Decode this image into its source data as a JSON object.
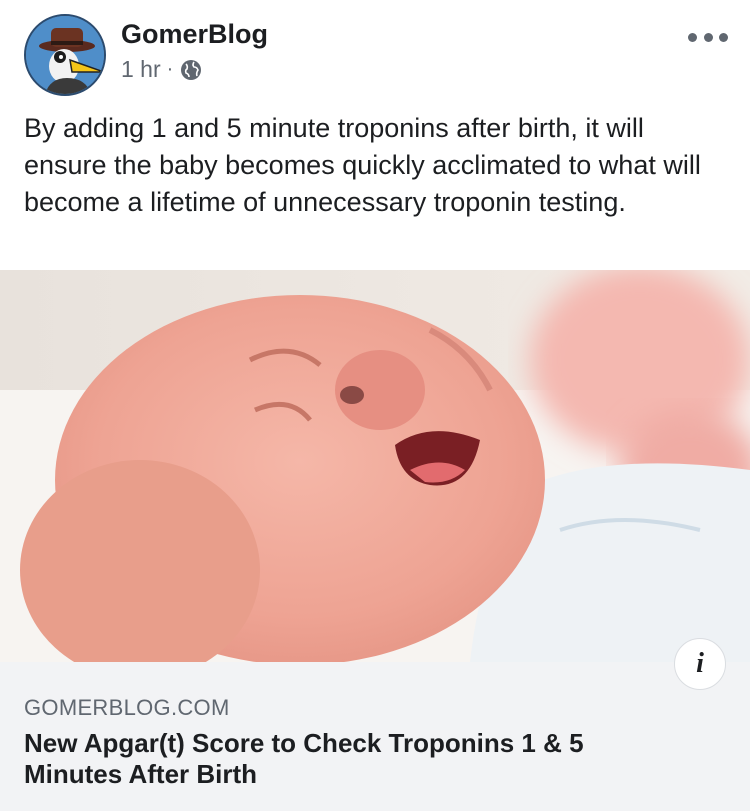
{
  "post": {
    "author": "GomerBlog",
    "time": "1 hr",
    "separator": "·",
    "privacy_icon": "globe-icon",
    "more_icon": "more-options-icon",
    "text": "By adding 1 and 5 minute troponins after birth, it will ensure the baby becomes quickly acclimated to what will become a lifetime of unnecessary troponin testing."
  },
  "link_preview": {
    "domain": "GOMERBLOG.COM",
    "headline": "New Apgar(t) Score to Check Troponins 1 & 5 Minutes After Birth",
    "info_label": "i"
  },
  "colors": {
    "text_primary": "#1c1e21",
    "text_secondary": "#606770",
    "preview_bg": "#f2f3f5"
  }
}
